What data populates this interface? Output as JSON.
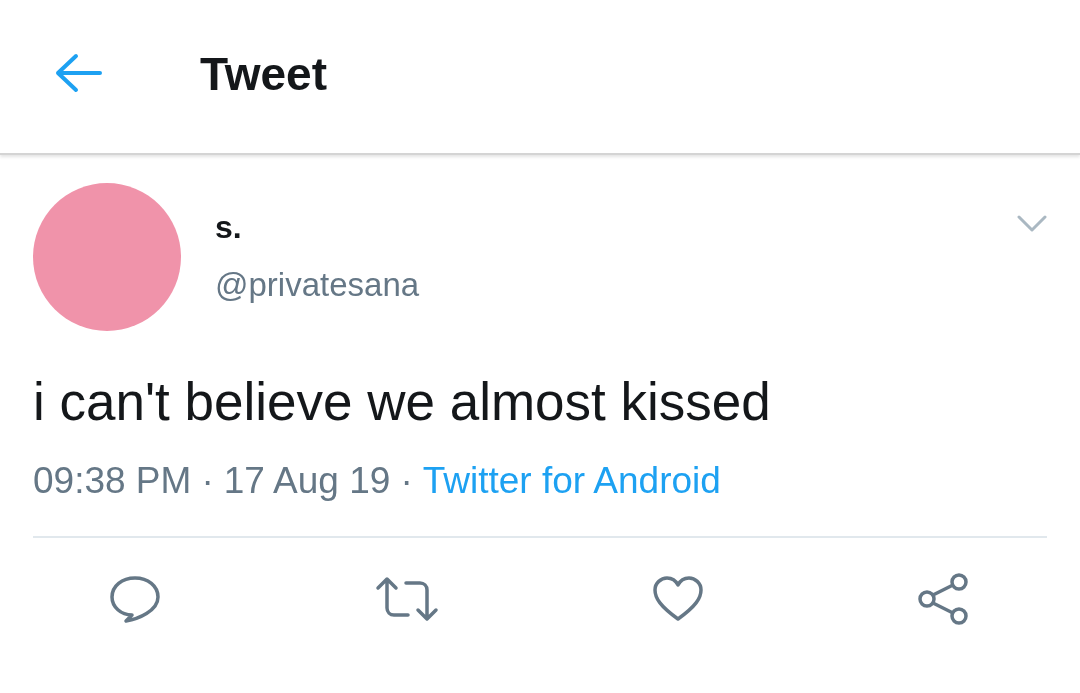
{
  "header": {
    "title": "Tweet"
  },
  "tweet": {
    "name": "s.",
    "handle": "@privatesana",
    "text": "i can't believe we almost kissed",
    "time": "09:38 PM",
    "separator_1": "·",
    "date": "17 Aug 19",
    "separator_2": "·",
    "source": "Twitter for Android"
  }
}
